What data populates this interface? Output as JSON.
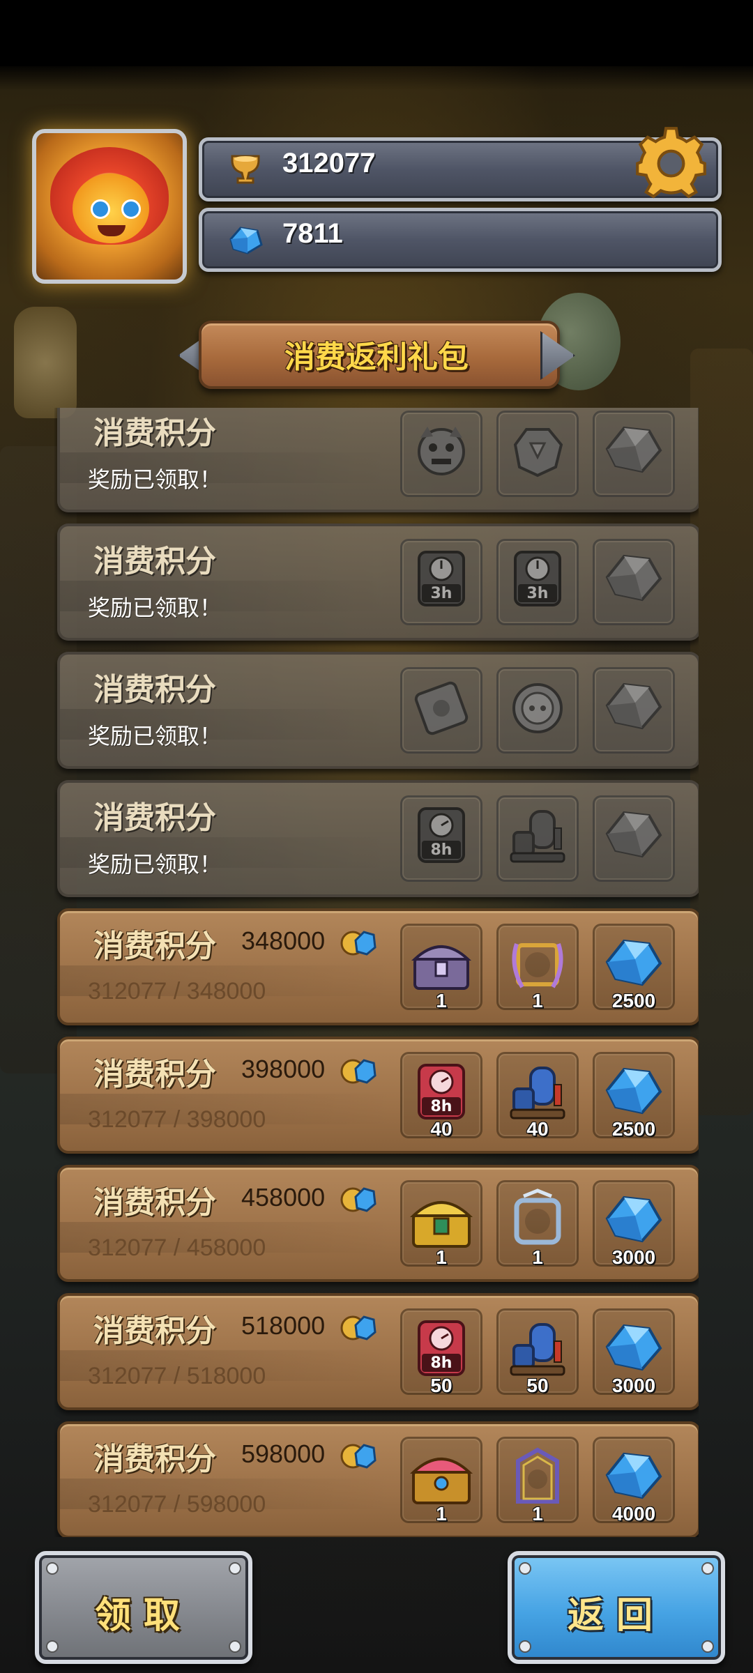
{
  "header": {
    "trophies": "312077",
    "gems": "7811",
    "avatar_icon": "lion-dragon-avatar",
    "settings_icon": "gear-icon"
  },
  "title": "消费返利礼包",
  "rows": [
    {
      "state": "claimed",
      "title": "消费积分",
      "status": "奖励已领取！",
      "rewards": [
        {
          "icon": "monster-head-icon",
          "qty": ""
        },
        {
          "icon": "stone-token-icon",
          "qty": ""
        },
        {
          "icon": "gem-icon",
          "qty": ""
        }
      ]
    },
    {
      "state": "claimed",
      "title": "消费积分",
      "status": "奖励已领取！",
      "rewards": [
        {
          "icon": "speedup-3h-icon",
          "qty": ""
        },
        {
          "icon": "speedup-3h-icon",
          "qty": ""
        },
        {
          "icon": "gem-icon",
          "qty": ""
        }
      ]
    },
    {
      "state": "claimed",
      "title": "消费积分",
      "status": "奖励已领取！",
      "rewards": [
        {
          "icon": "card-icon",
          "qty": ""
        },
        {
          "icon": "coin-token-icon",
          "qty": ""
        },
        {
          "icon": "gem-icon",
          "qty": ""
        }
      ]
    },
    {
      "state": "claimed",
      "title": "消费积分",
      "status": "奖励已领取！",
      "rewards": [
        {
          "icon": "speedup-8h-icon",
          "qty": ""
        },
        {
          "icon": "elixir-collector-icon",
          "qty": ""
        },
        {
          "icon": "gem-icon",
          "qty": ""
        }
      ]
    },
    {
      "state": "active",
      "title": "消费积分",
      "cost": "348000",
      "progress": "312077 / 348000",
      "rewards": [
        {
          "icon": "purple-chest-icon",
          "qty": "1"
        },
        {
          "icon": "laurel-frame-icon",
          "qty": "1"
        },
        {
          "icon": "gem-icon",
          "qty": "2500"
        }
      ]
    },
    {
      "state": "active",
      "title": "消费积分",
      "cost": "398000",
      "progress": "312077 / 398000",
      "rewards": [
        {
          "icon": "speedup-8h-icon",
          "qty": "40"
        },
        {
          "icon": "elixir-collector-icon",
          "qty": "40"
        },
        {
          "icon": "gem-icon",
          "qty": "2500"
        }
      ]
    },
    {
      "state": "active",
      "title": "消费积分",
      "cost": "458000",
      "progress": "312077 / 458000",
      "rewards": [
        {
          "icon": "gold-chest-icon",
          "qty": "1"
        },
        {
          "icon": "silver-frame-icon",
          "qty": "1"
        },
        {
          "icon": "gem-icon",
          "qty": "3000"
        }
      ]
    },
    {
      "state": "active",
      "title": "消费积分",
      "cost": "518000",
      "progress": "312077 / 518000",
      "rewards": [
        {
          "icon": "speedup-8h-icon",
          "qty": "50"
        },
        {
          "icon": "elixir-collector-icon",
          "qty": "50"
        },
        {
          "icon": "gem-icon",
          "qty": "3000"
        }
      ]
    },
    {
      "state": "active",
      "title": "消费积分",
      "cost": "598000",
      "progress": "312077 / 598000",
      "rewards": [
        {
          "icon": "jeweled-chest-icon",
          "qty": "1"
        },
        {
          "icon": "gothic-frame-icon",
          "qty": "1"
        },
        {
          "icon": "gem-icon",
          "qty": "4000"
        }
      ]
    }
  ],
  "buttons": {
    "claim": "领取",
    "back": "返回"
  }
}
